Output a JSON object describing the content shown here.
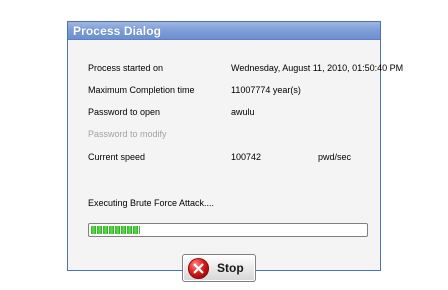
{
  "window": {
    "title": "Process Dialog"
  },
  "info": {
    "rows": [
      {
        "label": "Process started on",
        "value": "Wednesday, August 11, 2010, 01:50:40 PM"
      },
      {
        "label": "Maximum Completion time",
        "value": "11007774 year(s)"
      },
      {
        "label": "Password to open",
        "value": "awulu"
      },
      {
        "label": "Password to modify",
        "value": ""
      },
      {
        "label": "Current speed",
        "value": "100742",
        "unit": "pwd/sec"
      }
    ],
    "status": "Executing Brute Force Attack...."
  },
  "progress": {
    "value_fraction": 0.18,
    "color": "#38b52c"
  },
  "actions": {
    "stop_label": "Stop",
    "stop_icon": "red-x-circle-icon"
  }
}
